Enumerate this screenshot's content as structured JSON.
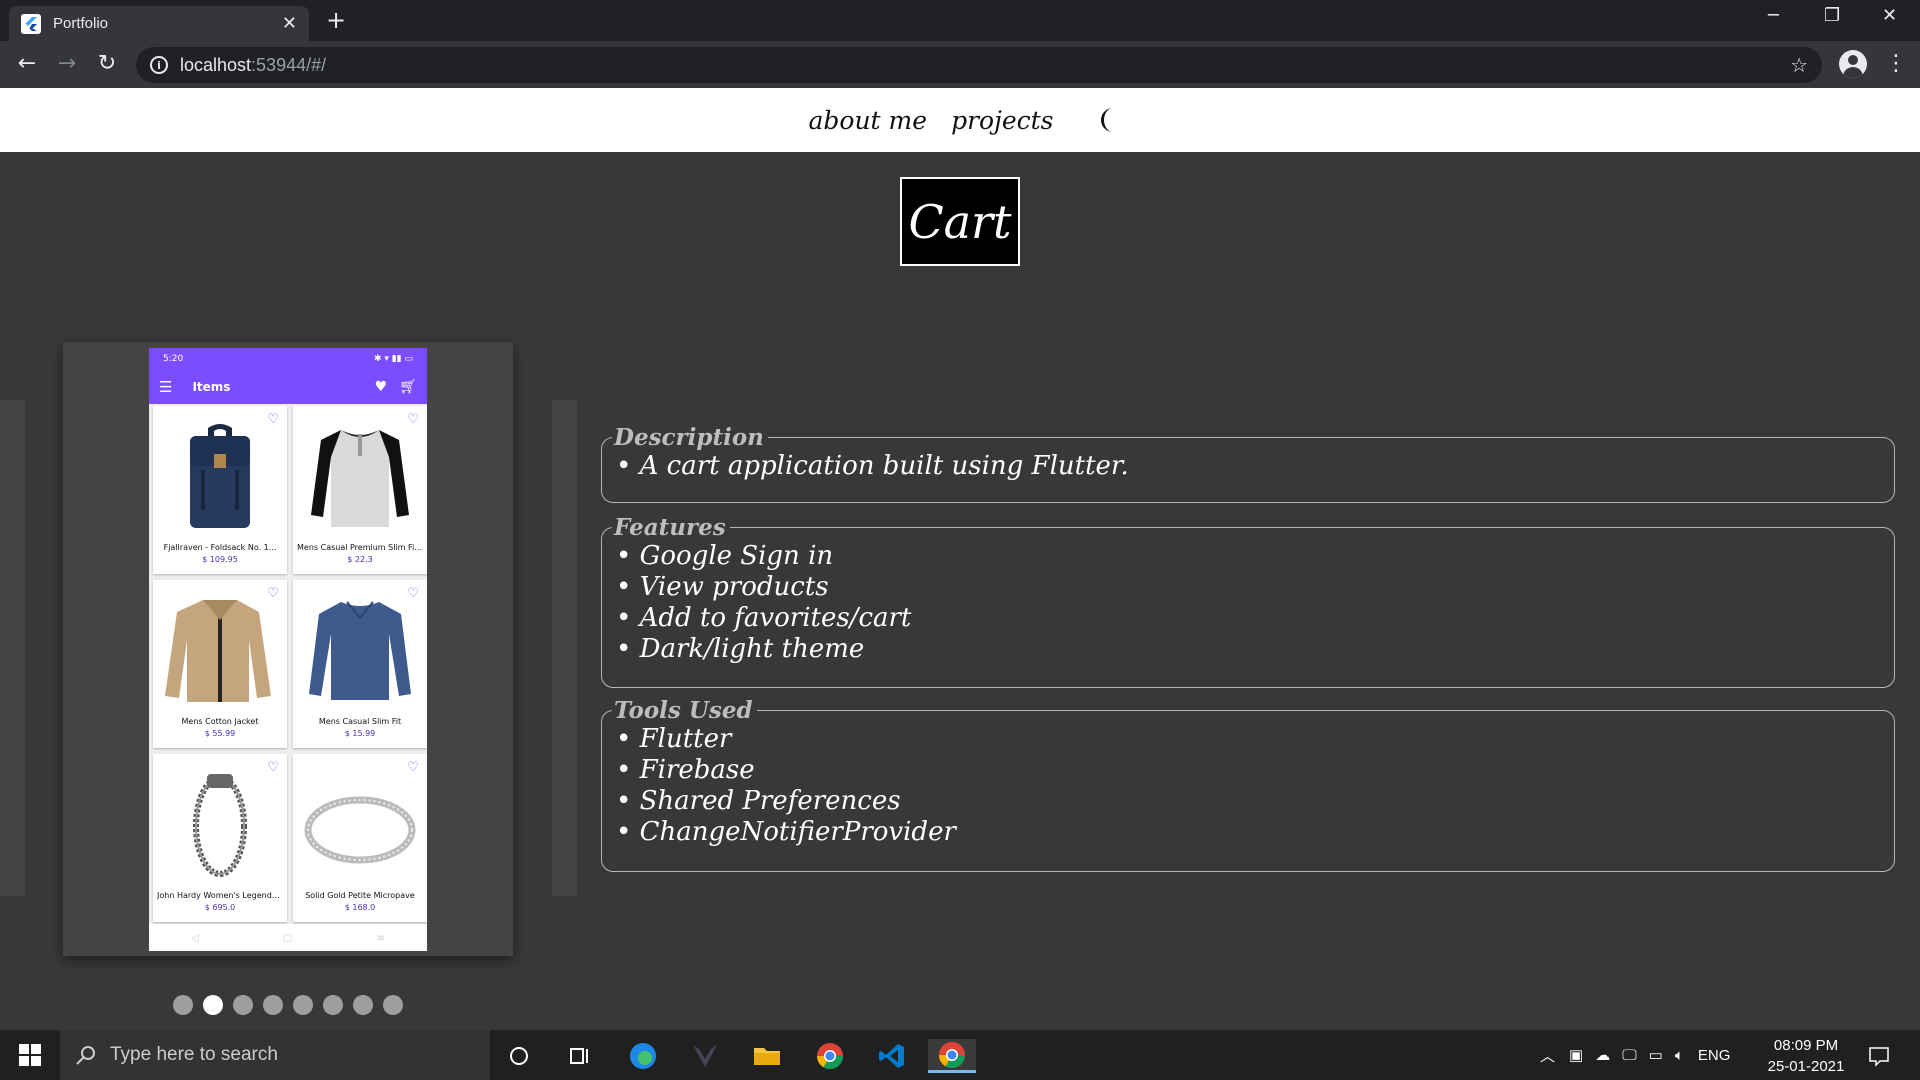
{
  "browser": {
    "tab_title": "Portfolio",
    "url_host": "localhost",
    "url_rest": ":53944/#/"
  },
  "site_nav": {
    "about": "about me",
    "projects": "projects"
  },
  "project": {
    "title": "Cart",
    "phone": {
      "status_time": "5:20",
      "appbar_title": "Items",
      "products": [
        {
          "name": "Fjallraven - Foldsack No. 1...",
          "price": "$ 109.95",
          "image": "backpack"
        },
        {
          "name": "Mens Casual Premium Slim Fit ...",
          "price": "$ 22.3",
          "image": "tshirt"
        },
        {
          "name": "Mens Cotton Jacket",
          "price": "$ 55.99",
          "image": "jacket"
        },
        {
          "name": "Mens Casual Slim Fit",
          "price": "$ 15.99",
          "image": "longsleeve"
        },
        {
          "name": "John Hardy Women's Legends...",
          "price": "$ 695.0",
          "image": "bracelet"
        },
        {
          "name": "Solid Gold Petite Micropave",
          "price": "$ 168.0",
          "image": "ring"
        }
      ]
    },
    "carousel": {
      "count": 8,
      "active_index": 1
    },
    "sections": {
      "description": {
        "legend": "Description",
        "items": [
          "• A cart application built using Flutter."
        ]
      },
      "features": {
        "legend": "Features",
        "items": [
          "• Google Sign in",
          "• View products",
          "• Add to favorites/cart",
          "• Dark/light theme"
        ]
      },
      "tools": {
        "legend": "Tools Used",
        "items": [
          "• Flutter",
          "• Firebase",
          "• Shared Preferences",
          "• ChangeNotifierProvider"
        ]
      }
    }
  },
  "taskbar": {
    "search_placeholder": "Type here to search",
    "language": "ENG",
    "time": "08:09 PM",
    "date": "25-01-2021"
  },
  "colors": {
    "page_bg": "#383838",
    "app_accent": "#7c4dff",
    "panel": "#444444"
  }
}
